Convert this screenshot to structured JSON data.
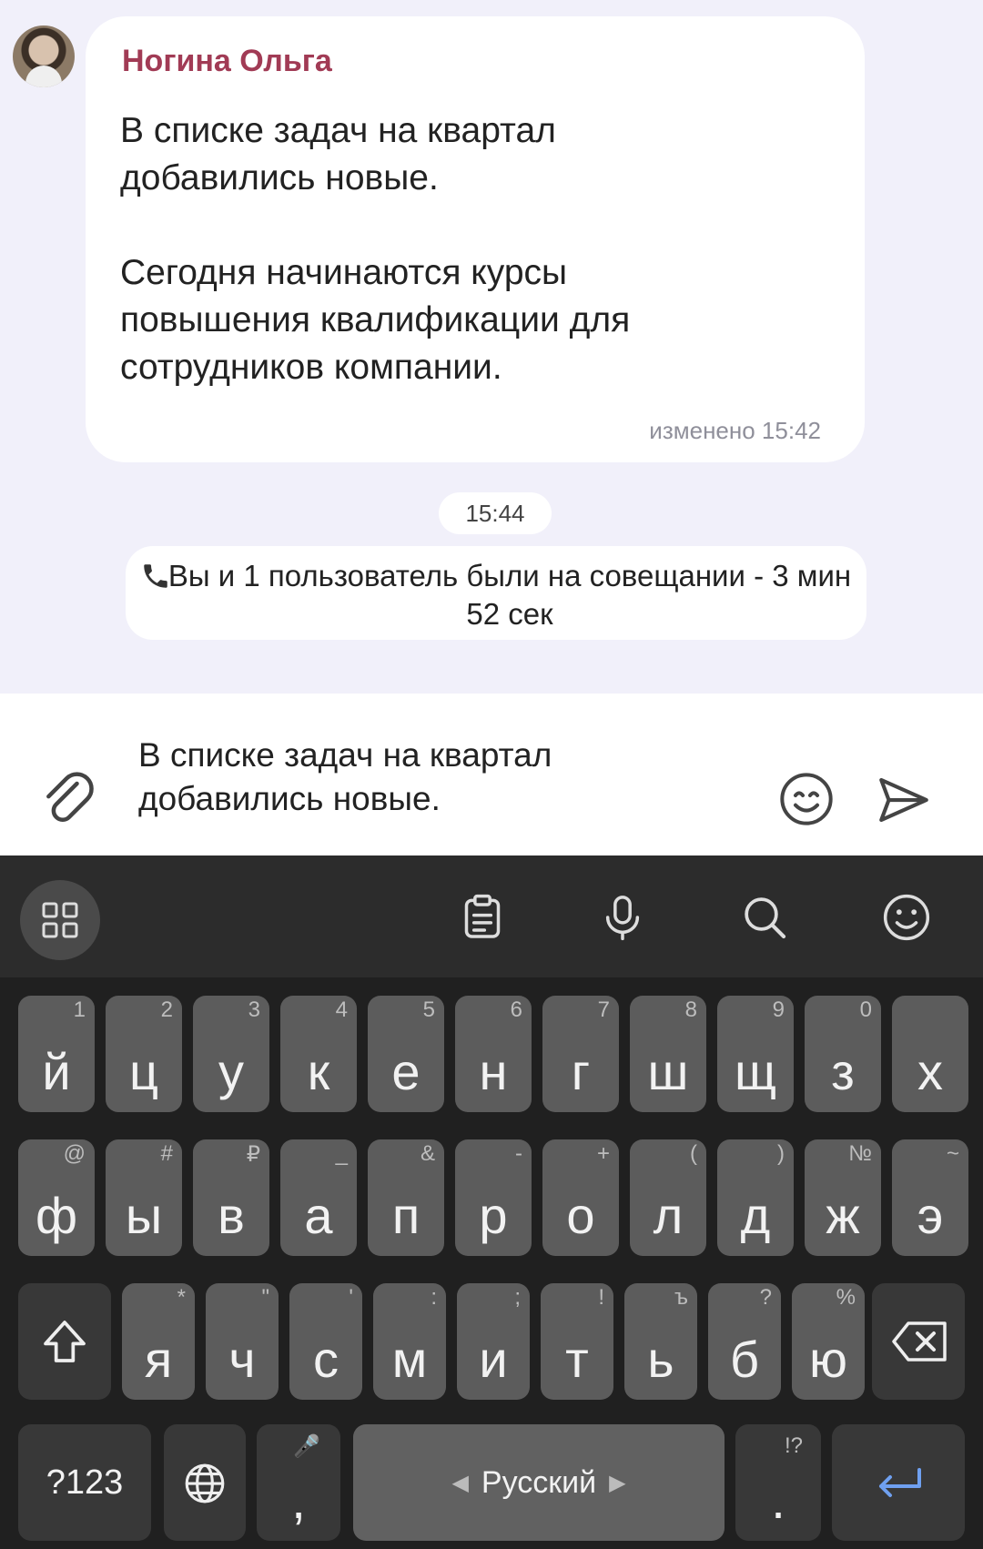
{
  "message": {
    "sender": "Ногина Ольга",
    "text": "В списке задач на квартал\nдобавились новые.\n\nСегодня начинаются курсы\nповышения квалификации для\nсотрудников компании.",
    "edited": "изменено 15:42"
  },
  "time_chip": "15:44",
  "call_event": {
    "text": "Вы и 1 пользователь были на совещании - 3 мин 52 сек",
    "icon": "phone-icon"
  },
  "composer": {
    "input_value": "В списке задач на квартал\nдобавились новые.",
    "icons": [
      "paperclip-icon",
      "emoji-icon",
      "send-icon"
    ]
  },
  "keyboard": {
    "toolbar_icons": [
      "apps-grid-icon",
      "clipboard-icon",
      "mic-icon",
      "search-icon",
      "emoji-icon"
    ],
    "row1": [
      {
        "k": "й",
        "h": "1"
      },
      {
        "k": "ц",
        "h": "2"
      },
      {
        "k": "у",
        "h": "3"
      },
      {
        "k": "к",
        "h": "4"
      },
      {
        "k": "е",
        "h": "5"
      },
      {
        "k": "н",
        "h": "6"
      },
      {
        "k": "г",
        "h": "7"
      },
      {
        "k": "ш",
        "h": "8"
      },
      {
        "k": "щ",
        "h": "9"
      },
      {
        "k": "з",
        "h": "0"
      },
      {
        "k": "х",
        "h": ""
      }
    ],
    "row2": [
      {
        "k": "ф",
        "h": "@"
      },
      {
        "k": "ы",
        "h": "#"
      },
      {
        "k": "в",
        "h": "₽"
      },
      {
        "k": "а",
        "h": "_"
      },
      {
        "k": "п",
        "h": "&"
      },
      {
        "k": "р",
        "h": "-"
      },
      {
        "k": "о",
        "h": "+"
      },
      {
        "k": "л",
        "h": "("
      },
      {
        "k": "д",
        "h": ")"
      },
      {
        "k": "ж",
        "h": "№"
      },
      {
        "k": "э",
        "h": "~"
      }
    ],
    "row3": [
      {
        "k": "я",
        "h": "*"
      },
      {
        "k": "ч",
        "h": "\""
      },
      {
        "k": "с",
        "h": "'"
      },
      {
        "k": "м",
        "h": ":"
      },
      {
        "k": "и",
        "h": ";"
      },
      {
        "k": "т",
        "h": "!"
      },
      {
        "k": "ь",
        "h": "ъ"
      },
      {
        "k": "б",
        "h": "?"
      },
      {
        "k": "ю",
        "h": "%"
      }
    ],
    "symbols_key": "?123",
    "comma_key": ",",
    "comma_hint": "🎤",
    "space_label": "Русский",
    "period_key": ".",
    "period_hint": "!?"
  }
}
